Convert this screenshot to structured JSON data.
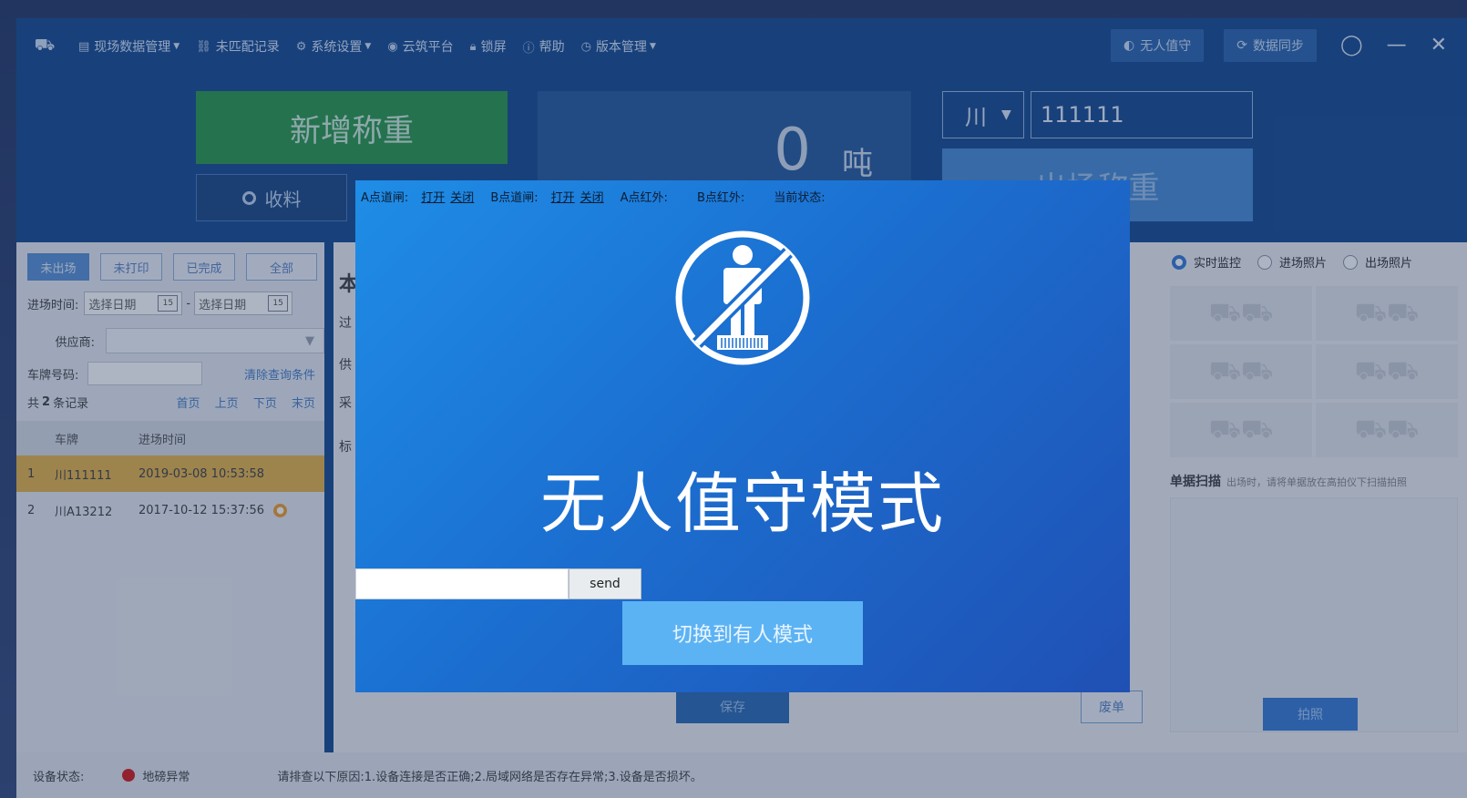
{
  "titlebar": {
    "menu": [
      {
        "icon": "document-icon",
        "label": "现场数据管理",
        "caret": true
      },
      {
        "icon": "link-icon",
        "label": "未匹配记录",
        "caret": false
      },
      {
        "icon": "gear-icon",
        "label": "系统设置",
        "caret": true
      },
      {
        "icon": "cloud-icon",
        "label": "云筑平台",
        "caret": false
      },
      {
        "icon": "lock-icon",
        "label": "锁屏",
        "caret": false
      },
      {
        "icon": "help-icon",
        "label": "帮助",
        "caret": false
      },
      {
        "icon": "clock-icon",
        "label": "版本管理",
        "caret": true
      }
    ],
    "unattended_label": "无人值守",
    "sync_label": "数据同步"
  },
  "top": {
    "add_weigh_label": "新增称重",
    "receive_label": "收料",
    "weight_value": "0",
    "weight_unit": "吨",
    "province": "川",
    "plate": "111111",
    "exit_weigh_label": "出场称重"
  },
  "left": {
    "tabs": [
      "未出场",
      "未打印",
      "已完成",
      "全部"
    ],
    "entry_time_label": "进场时间:",
    "date_placeholder": "选择日期",
    "cal_day": "15",
    "date_sep": "-",
    "supplier_label": "供应商:",
    "plate_label": "车牌号码:",
    "clear_label": "清除查询条件",
    "count_prefix": "共",
    "count": "2",
    "count_suffix": "条记录",
    "pager": [
      "首页",
      "上页",
      "下页",
      "末页"
    ],
    "columns": [
      "车牌",
      "进场时间"
    ],
    "rows": [
      {
        "idx": "1",
        "plate": "川111111",
        "time": "2019-03-08 10:53:58"
      },
      {
        "idx": "2",
        "plate": "川A13212",
        "time": "2017-10-12 15:37:56"
      }
    ]
  },
  "mid": {
    "letters": [
      "本",
      "过",
      "供",
      "采",
      "标"
    ],
    "save_label": "保存",
    "void_label": "废单"
  },
  "right": {
    "radios": [
      "实时监控",
      "进场照片",
      "出场照片"
    ],
    "scan_title": "单据扫描",
    "scan_hint": "出场时，请将单据放在高拍仪下扫描拍照",
    "photo_label": "拍照"
  },
  "status": {
    "label": "设备状态:",
    "state": "地磅异常",
    "message": "请排查以下原因:1.设备连接是否正确;2.局域网络是否存在异常;3.设备是否损坏。"
  },
  "modal": {
    "a_gate": "A点道闸:",
    "open": "打开",
    "close": "关闭",
    "b_gate": "B点道闸:",
    "a_ir": "A点红外:",
    "b_ir": "B点红外:",
    "current_state": "当前状态:",
    "title": "无人值守模式",
    "send_label": "send",
    "switch_label": "切换到有人模式"
  },
  "colors": {
    "primary_bg": "#1b4f94",
    "add_green": "#2f9a4d",
    "modal_blue": "#1b6fd0",
    "switch_blue": "#5cb3f4",
    "status_red": "#d62020"
  }
}
